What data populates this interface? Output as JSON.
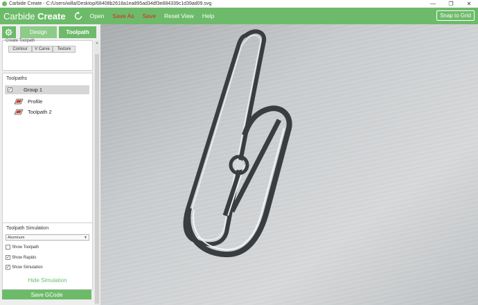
{
  "window": {
    "title": "Carbide Create - C:/Users/willa/Desktop/68408b2618a1ea895ad34df3e884339c1d39ad09.svg",
    "controls": [
      "—",
      "❐",
      "✕"
    ]
  },
  "appbar": {
    "brand_light": "Carbide ",
    "brand_bold": "Create",
    "menu": [
      {
        "label": "Open",
        "color": "#ffffff"
      },
      {
        "label": "Save As",
        "color": "#d9261c"
      },
      {
        "label": "Save",
        "color": "#d9261c"
      },
      {
        "label": "Reset View",
        "color": "#ffffff"
      },
      {
        "label": "Help",
        "color": "#ffffff"
      }
    ],
    "snap_label": "Snap to Grid"
  },
  "tabs": {
    "design": "Design",
    "toolpath": "Toolpath",
    "active": "toolpath"
  },
  "create_toolpath": {
    "label": "Create Toolpath",
    "buttons": [
      "Contour",
      "V Carve",
      "Texture"
    ]
  },
  "toolpaths": {
    "title": "Toolpaths",
    "group": {
      "label": "Group 1",
      "checked": true
    },
    "items": [
      {
        "label": "Profile"
      },
      {
        "label": "Toolpath 2"
      }
    ]
  },
  "simulation": {
    "title": "Toolpath Simulation",
    "material": "Aluminum",
    "options": [
      {
        "label": "Show Toolpath",
        "checked": false
      },
      {
        "label": "Show Rapids",
        "checked": true
      },
      {
        "label": "Show Simulation",
        "checked": true
      }
    ],
    "hide_label": "Hide Simulation",
    "save_gcode": "Save GCode"
  },
  "colors": {
    "accent": "#6dbb6a",
    "warning": "#d9261c",
    "metal": "#c9ccce"
  },
  "icons": {
    "refresh": "refresh-icon",
    "gear": "gear-icon",
    "toolpath": "toolpath-icon"
  }
}
